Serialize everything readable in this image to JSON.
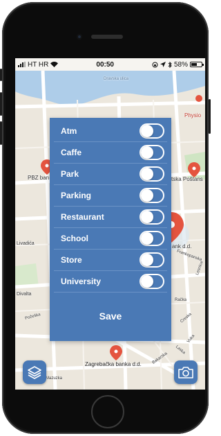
{
  "status_bar": {
    "carrier": "HT HR",
    "time": "00:50",
    "battery_percent": "58%",
    "battery_level": 0.58
  },
  "map": {
    "labels": {
      "dravska": "Dravska ulica",
      "physio": "Physio",
      "pbz": "PBZ ban",
      "postanska": "tska Poštans",
      "bank_dd": "ank d.d.",
      "frankopanska": "Frankopanska",
      "livadica": "Livadića",
      "divalta": "Divalta",
      "pozeska": "Požeška",
      "zagrebacka": "Zagrebačka banka d.d.",
      "bakarska": "Bakarska",
      "vuka": "Vuka",
      "crikvi": "Creska",
      "lesnica": "Lesnica",
      "mazuzka": "Mazuzka",
      "racka": "Račka",
      "laska": "Laska"
    },
    "colors": {
      "river": "#aecde9",
      "land": "#ece7dd",
      "road": "#ffffff",
      "park": "#cfe5c3",
      "pin": "#e4543f"
    }
  },
  "filters": [
    {
      "label": "Atm",
      "enabled": false
    },
    {
      "label": "Caffe",
      "enabled": false
    },
    {
      "label": "Park",
      "enabled": false
    },
    {
      "label": "Parking",
      "enabled": false
    },
    {
      "label": "Restaurant",
      "enabled": false
    },
    {
      "label": "School",
      "enabled": false
    },
    {
      "label": "Store",
      "enabled": false
    },
    {
      "label": "University",
      "enabled": false
    }
  ],
  "save_label": "Save",
  "buttons": {
    "layers_icon": "layers-icon",
    "camera_icon": "camera-icon"
  },
  "accent_color": "#4a79b5"
}
